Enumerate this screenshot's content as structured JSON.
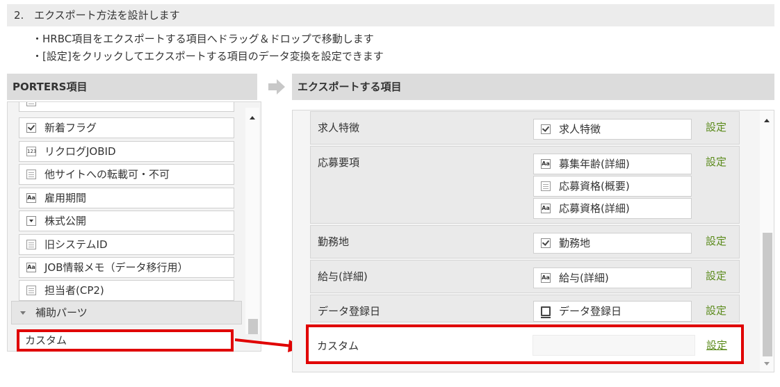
{
  "step": {
    "number": "2.",
    "title": "エクスポート方法を設計します"
  },
  "notes": [
    "・HRBC項目をエクスポートする項目へドラッグ＆ドロップで移動します",
    "・[設定]をクリックしてエクスポートする項目のデータ変換を設定できます"
  ],
  "left_panel": {
    "title": "PORTERS項目",
    "items": [
      {
        "label": "新着フラグ",
        "icon": "checkbox-icon"
      },
      {
        "label": "リクログJOBID",
        "icon": "number-icon"
      },
      {
        "label": "他サイトへの転載可・不可",
        "icon": "document-icon"
      },
      {
        "label": "雇用期間",
        "icon": "text-icon"
      },
      {
        "label": "株式公開",
        "icon": "dropdown-icon"
      },
      {
        "label": "旧システムID",
        "icon": "document-icon"
      },
      {
        "label": "JOB情報メモ（データ移行用）",
        "icon": "text-icon"
      },
      {
        "label": "担当者(CP2)",
        "icon": "document-icon"
      }
    ],
    "group_label": "補助パーツ",
    "dragging_item": "カスタム"
  },
  "right_panel": {
    "title": "エクスポートする項目",
    "setting_label": "設定",
    "rows": [
      {
        "label": "求人特徴",
        "fields": [
          {
            "label": "求人特徴",
            "icon": "checkbox-icon"
          }
        ]
      },
      {
        "label": "応募要項",
        "fields": [
          {
            "label": "募集年齢(詳細)",
            "icon": "text-icon"
          },
          {
            "label": "応募資格(概要)",
            "icon": "document-icon"
          },
          {
            "label": "応募資格(詳細)",
            "icon": "text-icon"
          }
        ]
      },
      {
        "label": "勤務地",
        "fields": [
          {
            "label": "勤務地",
            "icon": "checkbox-icon"
          }
        ]
      },
      {
        "label": "給与(詳細)",
        "fields": [
          {
            "label": "給与(詳細)",
            "icon": "text-icon"
          }
        ]
      },
      {
        "label": "データ登録日",
        "fields": [
          {
            "label": "データ登録日",
            "icon": "monitor-icon"
          }
        ]
      }
    ],
    "custom_row": {
      "label": "カスタム",
      "setting": "設定"
    }
  },
  "colors": {
    "highlight": "#e00000",
    "setting_link": "#5a8a1a"
  }
}
